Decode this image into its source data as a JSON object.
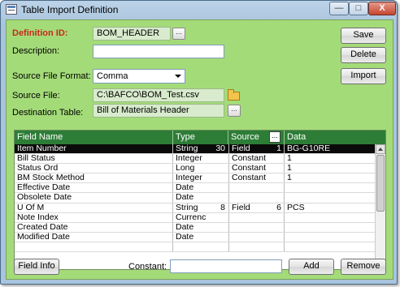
{
  "window": {
    "title": "Table Import Definition",
    "min_label": "—",
    "max_label": "□",
    "close_label": "X"
  },
  "form": {
    "definition_id_label": "Definition ID:",
    "definition_id_value": "BOM_HEADER",
    "description_label": "Description:",
    "description_value": "",
    "source_format_label": "Source File Format:",
    "source_format_value": "Comma",
    "source_file_label": "Source File:",
    "source_file_value": "C:\\BAFCO\\BOM_Test.csv",
    "destination_table_label": "Destination Table:",
    "destination_table_value": "Bill of Materials Header",
    "ellipsis": "..."
  },
  "buttons": {
    "save": "Save",
    "delete": "Delete",
    "import": "Import",
    "field_info": "Field Info",
    "add": "Add",
    "remove": "Remove"
  },
  "constant": {
    "label": "Constant:",
    "value": ""
  },
  "grid": {
    "headers": {
      "field_name": "Field Name",
      "type": "Type",
      "source": "Source",
      "data": "Data"
    },
    "rows": [
      {
        "name": "Item Number",
        "type": "String",
        "len": "30",
        "source": "Field",
        "pos": "1",
        "data": "BG-G10RE",
        "selected": true
      },
      {
        "name": "Bill Status",
        "type": "Integer",
        "len": "",
        "source": "Constant",
        "pos": "",
        "data": "1"
      },
      {
        "name": "Status Ord",
        "type": "Long",
        "len": "",
        "source": "Constant",
        "pos": "",
        "data": "1"
      },
      {
        "name": "BM Stock Method",
        "type": "Integer",
        "len": "",
        "source": "Constant",
        "pos": "",
        "data": "1"
      },
      {
        "name": "Effective Date",
        "type": "Date",
        "len": "",
        "source": "",
        "pos": "",
        "data": ""
      },
      {
        "name": "Obsolete Date",
        "type": "Date",
        "len": "",
        "source": "",
        "pos": "",
        "data": ""
      },
      {
        "name": "U Of M",
        "type": "String",
        "len": "8",
        "source": "Field",
        "pos": "6",
        "data": "PCS"
      },
      {
        "name": "Note Index",
        "type": "Currency",
        "len": "",
        "source": "",
        "pos": "",
        "data": ""
      },
      {
        "name": "Created Date",
        "type": "Date",
        "len": "",
        "source": "",
        "pos": "",
        "data": ""
      },
      {
        "name": "Modified Date",
        "type": "Date",
        "len": "",
        "source": "",
        "pos": "",
        "data": ""
      },
      {
        "name": "",
        "type": "",
        "len": "",
        "source": "",
        "pos": "",
        "data": ""
      }
    ]
  }
}
